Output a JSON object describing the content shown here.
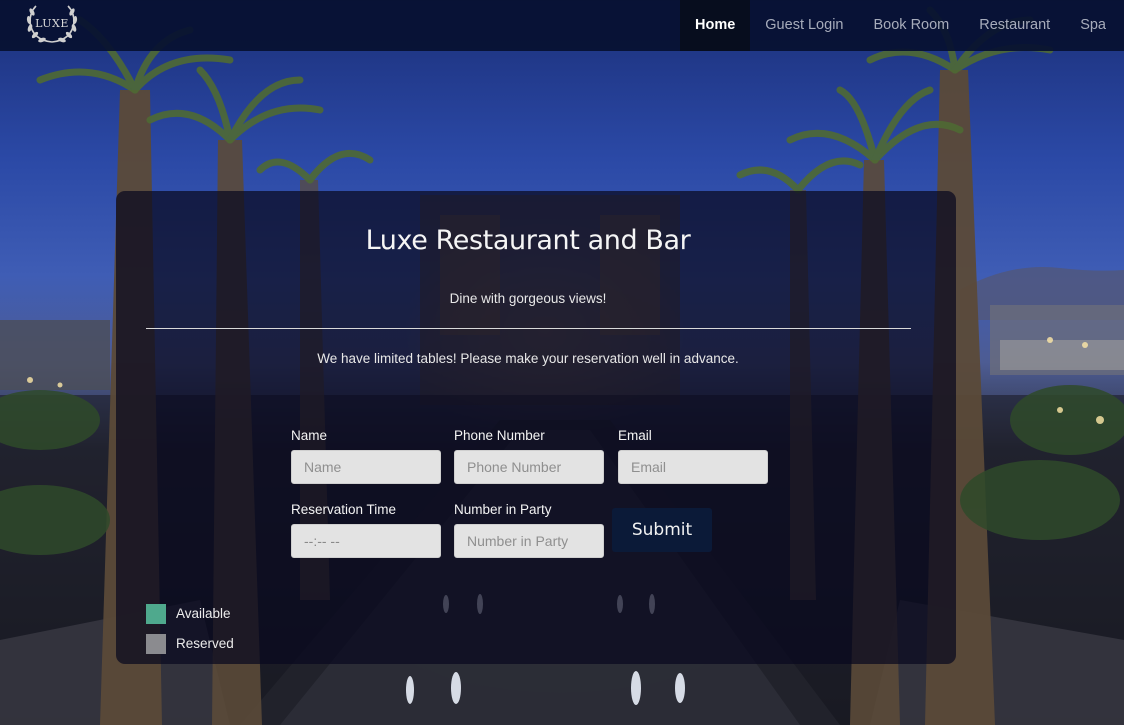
{
  "navbar": {
    "logo_text": "LUXE",
    "items": [
      {
        "label": "Home",
        "active": true
      },
      {
        "label": "Guest Login",
        "active": false
      },
      {
        "label": "Book Room",
        "active": false
      },
      {
        "label": "Restaurant",
        "active": false
      },
      {
        "label": "Spa",
        "active": false
      }
    ]
  },
  "panel": {
    "title": "Luxe Restaurant and Bar",
    "subtitle": "Dine with gorgeous views!",
    "note": "We have limited tables!  Please make your reservation well in advance."
  },
  "form": {
    "name": {
      "label": "Name",
      "placeholder": "Name"
    },
    "phone": {
      "label": "Phone Number",
      "placeholder": "Phone Number"
    },
    "email": {
      "label": "Email",
      "placeholder": "Email"
    },
    "time": {
      "label": "Reservation Time",
      "value": "--:-- --"
    },
    "party": {
      "label": "Number in Party",
      "placeholder": "Number in Party"
    },
    "submit_label": "Submit"
  },
  "legend": [
    {
      "label": "Available",
      "color": "#4fa98d"
    },
    {
      "label": "Reserved",
      "color": "#8b8b8f"
    }
  ],
  "colors": {
    "navbar_bg": "#061030",
    "active_tab_bg": "#070d1e",
    "submit_bg": "#0b1a38"
  }
}
